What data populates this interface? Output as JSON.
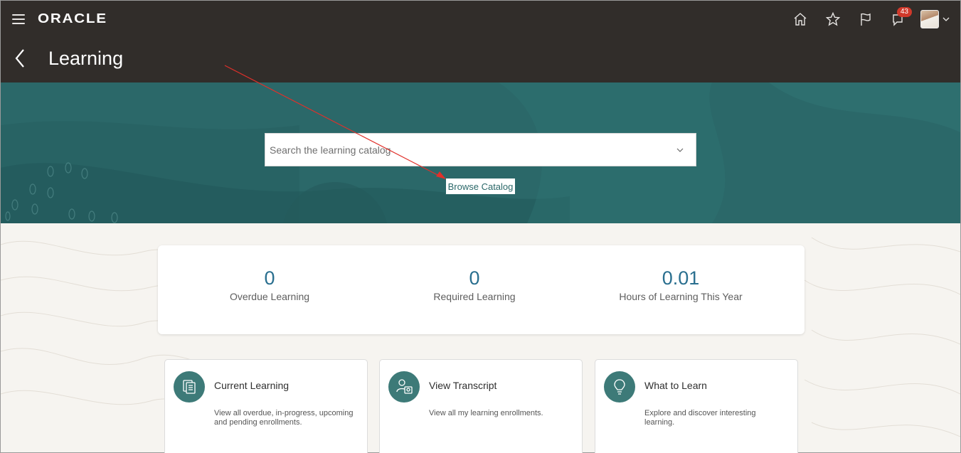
{
  "header": {
    "logo": "ORACLE",
    "page_title": "Learning",
    "notifications_count": "43",
    "icons": [
      "menu-icon",
      "home-icon",
      "star-icon",
      "flag-icon",
      "notifications-icon",
      "avatar",
      "chevron-down-icon",
      "back-icon"
    ]
  },
  "hero": {
    "search_placeholder": "Search the learning catalog",
    "browse_label": "Browse Catalog",
    "color": "#2b6869"
  },
  "stats": [
    {
      "value": "0",
      "label": "Overdue Learning"
    },
    {
      "value": "0",
      "label": "Required Learning"
    },
    {
      "value": "0.01",
      "label": "Hours of Learning This Year"
    }
  ],
  "tiles": [
    {
      "title": "Current Learning",
      "desc": "View all overdue, in-progress, upcoming and pending enrollments.",
      "icon": "documents-icon"
    },
    {
      "title": "View Transcript",
      "desc": "View all my learning enrollments.",
      "icon": "transcript-icon"
    },
    {
      "title": "What to Learn",
      "desc": "Explore and discover interesting learning.",
      "icon": "lightbulb-icon"
    }
  ],
  "colors": {
    "header_bg": "#312d2a",
    "accent": "#2a6f8f",
    "annotation_arrow": "#e0302a"
  }
}
